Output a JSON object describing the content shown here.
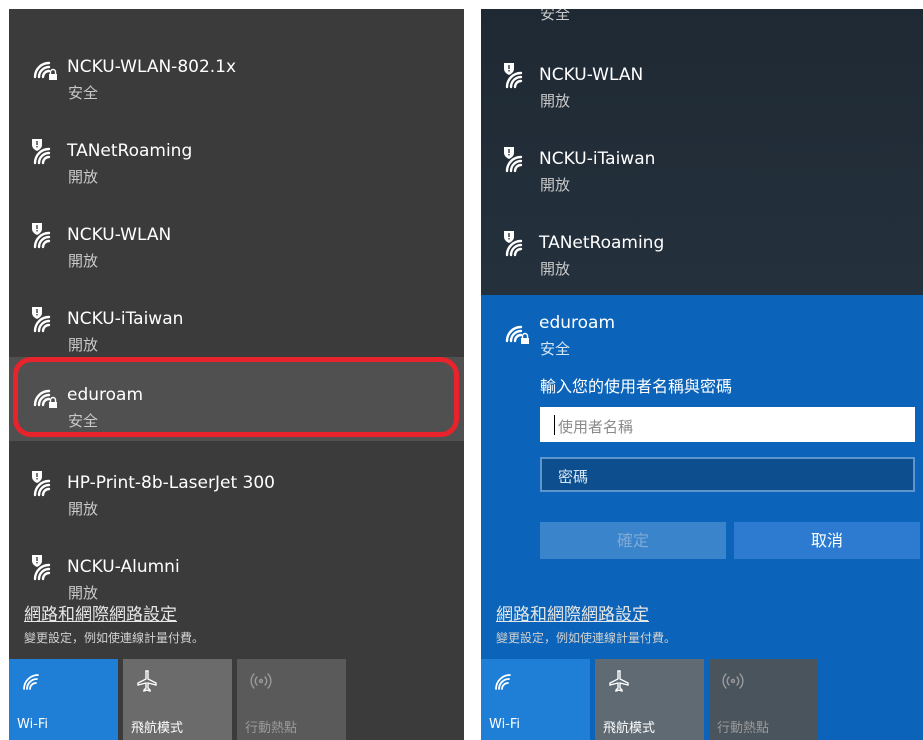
{
  "left": {
    "networks": [
      {
        "ssid": "NCKU-WLAN-802.1x",
        "state": "安全",
        "icon": "wifi-secured-icon"
      },
      {
        "ssid": "TANetRoaming",
        "state": "開放",
        "icon": "wifi-open-shield-icon"
      },
      {
        "ssid": "NCKU-WLAN",
        "state": "開放",
        "icon": "wifi-open-shield-icon"
      },
      {
        "ssid": "NCKU-iTaiwan",
        "state": "開放",
        "icon": "wifi-open-shield-icon"
      },
      {
        "ssid": "eduroam",
        "state": "安全",
        "icon": "wifi-secured-icon"
      },
      {
        "ssid": "HP-Print-8b-LaserJet 300",
        "state": "開放",
        "icon": "wifi-open-shield-icon"
      },
      {
        "ssid": "NCKU-Alumni",
        "state": "開放",
        "icon": "wifi-open-shield-icon"
      }
    ],
    "settings_link": "網路和網際網路設定",
    "settings_desc": "變更設定，例如使連線計量付費。",
    "tiles": [
      {
        "label": "Wi-Fi",
        "icon": "wifi-icon",
        "active": true
      },
      {
        "label": "飛航模式",
        "icon": "airplane-icon",
        "active": false
      },
      {
        "label": "行動熱點",
        "icon": "hotspot-icon",
        "active": false,
        "disabled": true
      }
    ]
  },
  "right": {
    "top_cut_state": "安全",
    "networks": [
      {
        "ssid": "NCKU-WLAN",
        "state": "開放"
      },
      {
        "ssid": "NCKU-iTaiwan",
        "state": "開放"
      },
      {
        "ssid": "TANetRoaming",
        "state": "開放"
      }
    ],
    "selected": {
      "ssid": "eduroam",
      "state": "安全",
      "prompt": "輸入您的使用者名稱與密碼",
      "username_placeholder": "使用者名稱",
      "password_placeholder": "密碼",
      "ok_label": "確定",
      "cancel_label": "取消"
    },
    "settings_link": "網路和網際網路設定",
    "settings_desc": "變更設定，例如使連線計量付費。",
    "tiles": [
      {
        "label": "Wi-Fi"
      },
      {
        "label": "飛航模式"
      },
      {
        "label": "行動熱點"
      }
    ]
  },
  "colors": {
    "accent": "#0b64b9",
    "tile_active": "#1f7fd6",
    "tile_inactive": "#6b6b6b",
    "highlight_ring": "#e8232b"
  }
}
